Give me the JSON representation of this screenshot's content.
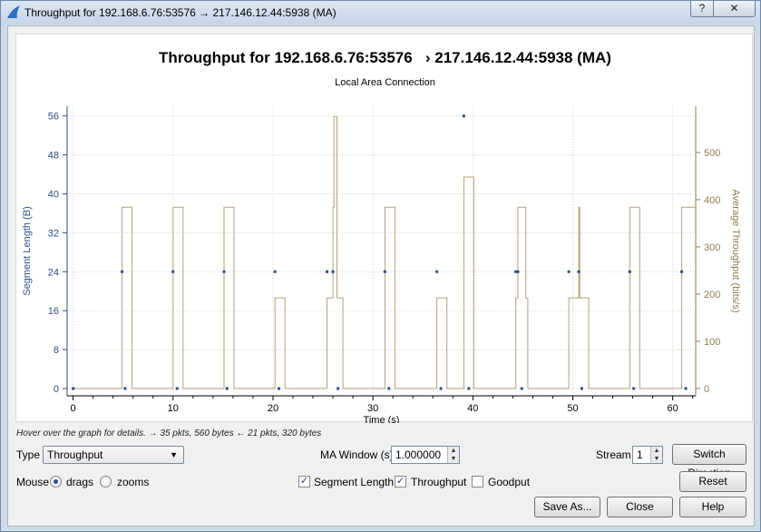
{
  "window": {
    "title": "Throughput for 192.168.6.76:53576 → 217.146.12.44:5938 (MA)",
    "help_label": "?",
    "close_label": "✕"
  },
  "plot": {
    "title": "Throughput for 192.168.6.76:53576   › 217.146.12.44:5938 (MA)",
    "subtitle": "Local Area Connection"
  },
  "chart_data": {
    "type": "scatter",
    "title": "Throughput for 192.168.6.76:53576 → 217.146.12.44:5938 (MA)",
    "subtitle": "Local Area Connection",
    "xlabel": "Time (s)",
    "ylabel": "Segment Length (B)",
    "y2label": "Average Throughput (bits/s)",
    "xlim": [
      -0.6,
      62.3
    ],
    "ylim": [
      -1.5,
      58
    ],
    "y2lim": [
      -15.5,
      598
    ],
    "xticks": [
      0,
      10,
      20,
      30,
      40,
      50,
      60
    ],
    "yticks": [
      0,
      8,
      16,
      24,
      32,
      40,
      48,
      56
    ],
    "y2ticks": [
      0,
      100,
      200,
      300,
      400,
      500
    ],
    "grid": true,
    "series": [
      {
        "name": "Segment Length",
        "axis": "left",
        "color": "#2d4f86",
        "points": [
          [
            0,
            0
          ],
          [
            4.9,
            24
          ],
          [
            5.2,
            0
          ],
          [
            10.0,
            24
          ],
          [
            10.4,
            0
          ],
          [
            15.1,
            24
          ],
          [
            15.4,
            0
          ],
          [
            20.2,
            24
          ],
          [
            20.6,
            0
          ],
          [
            25.4,
            24
          ],
          [
            26.0,
            24
          ],
          [
            26.5,
            0
          ],
          [
            31.2,
            24
          ],
          [
            31.6,
            0
          ],
          [
            36.4,
            24
          ],
          [
            36.8,
            0
          ],
          [
            39.1,
            56
          ],
          [
            39.6,
            0
          ],
          [
            44.3,
            24
          ],
          [
            44.5,
            24
          ],
          [
            44.9,
            0
          ],
          [
            49.6,
            24
          ],
          [
            50.6,
            24
          ],
          [
            50.9,
            0
          ],
          [
            55.7,
            24
          ],
          [
            56.1,
            0
          ],
          [
            60.9,
            24
          ],
          [
            61.3,
            0
          ]
        ]
      },
      {
        "name": "Throughput",
        "axis": "right",
        "color": "#b3a079",
        "steps": [
          [
            0,
            0
          ],
          [
            4.9,
            0
          ],
          [
            4.9,
            384
          ],
          [
            5.9,
            384
          ],
          [
            5.9,
            0
          ],
          [
            10.0,
            0
          ],
          [
            10.0,
            384
          ],
          [
            11.0,
            384
          ],
          [
            11.0,
            0
          ],
          [
            15.1,
            0
          ],
          [
            15.1,
            384
          ],
          [
            16.1,
            384
          ],
          [
            16.1,
            0
          ],
          [
            20.2,
            0
          ],
          [
            20.2,
            192
          ],
          [
            21.2,
            192
          ],
          [
            21.2,
            0
          ],
          [
            25.4,
            0
          ],
          [
            25.4,
            192
          ],
          [
            26.0,
            192
          ],
          [
            26.0,
            384
          ],
          [
            26.1,
            384
          ],
          [
            26.1,
            576
          ],
          [
            26.4,
            576
          ],
          [
            26.4,
            192
          ],
          [
            27.0,
            192
          ],
          [
            27.0,
            0
          ],
          [
            31.2,
            0
          ],
          [
            31.2,
            384
          ],
          [
            32.2,
            384
          ],
          [
            32.2,
            0
          ],
          [
            36.4,
            0
          ],
          [
            36.4,
            192
          ],
          [
            37.4,
            192
          ],
          [
            37.4,
            0
          ],
          [
            39.1,
            0
          ],
          [
            39.1,
            448
          ],
          [
            40.1,
            448
          ],
          [
            40.1,
            0
          ],
          [
            44.3,
            0
          ],
          [
            44.3,
            192
          ],
          [
            44.5,
            192
          ],
          [
            44.5,
            384
          ],
          [
            45.3,
            384
          ],
          [
            45.3,
            192
          ],
          [
            45.5,
            192
          ],
          [
            45.5,
            0
          ],
          [
            49.6,
            0
          ],
          [
            49.6,
            192
          ],
          [
            50.6,
            192
          ],
          [
            50.6,
            384
          ],
          [
            50.7,
            384
          ],
          [
            50.7,
            192
          ],
          [
            51.6,
            192
          ],
          [
            51.6,
            0
          ],
          [
            55.7,
            0
          ],
          [
            55.7,
            384
          ],
          [
            56.7,
            384
          ],
          [
            56.7,
            0
          ],
          [
            60.9,
            0
          ],
          [
            60.9,
            384
          ],
          [
            62.3,
            384
          ]
        ]
      }
    ]
  },
  "controls": {
    "hint": "Hover over the graph for details. → 35 pkts, 560 bytes ← 21 pkts, 320 bytes",
    "type_label": "Type",
    "type_value": "Throughput",
    "ma_window_label": "MA Window (s)",
    "ma_window_value": "1.000000",
    "stream_label": "Stream",
    "stream_value": "1",
    "switch_direction": "Switch Direction",
    "mouse_label": "Mouse",
    "drags_label": "drags",
    "zooms_label": "zooms",
    "mouse_mode": "drags",
    "segment_length_label": "Segment Length",
    "segment_length_checked": true,
    "throughput_label": "Throughput",
    "throughput_checked": true,
    "goodput_label": "Goodput",
    "goodput_checked": false,
    "reset": "Reset",
    "save_as": "Save As...",
    "close": "Close",
    "help": "Help"
  },
  "colors": {
    "segment_axis": "#2d4f86",
    "throughput_axis": "#8f7b4e",
    "window_bg": "#cfdbe9"
  }
}
